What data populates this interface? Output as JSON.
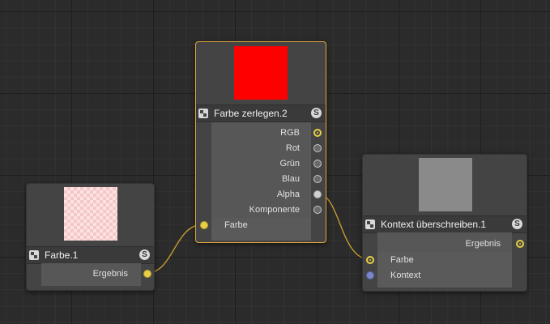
{
  "nodes": {
    "farbe": {
      "title": "Farbe.1",
      "solo": "S",
      "outputs": {
        "ergebnis": "Ergebnis"
      }
    },
    "zerlegen": {
      "title": "Farbe zerlegen.2",
      "solo": "S",
      "outputs": {
        "rgb": "RGB",
        "rot": "Rot",
        "gruen": "Grün",
        "blau": "Blau",
        "alpha": "Alpha",
        "komponente": "Komponente"
      },
      "inputs": {
        "farbe": "Farbe"
      }
    },
    "kontext": {
      "title": "Kontext überschreiben.1",
      "solo": "S",
      "outputs": {
        "ergebnis": "Ergebnis"
      },
      "inputs": {
        "farbe": "Farbe",
        "kontext": "Kontext"
      }
    }
  },
  "colors": {
    "wire": "#c59a2f",
    "selection_border": "#e0a93a",
    "preview_red": "#ff0000",
    "preview_grey": "#8a8a8a",
    "port_color": "#e7cf45",
    "port_context": "#7a86c8"
  },
  "icons": {
    "node_icon": "node-type-icon",
    "solo_icon": "solo-icon"
  }
}
